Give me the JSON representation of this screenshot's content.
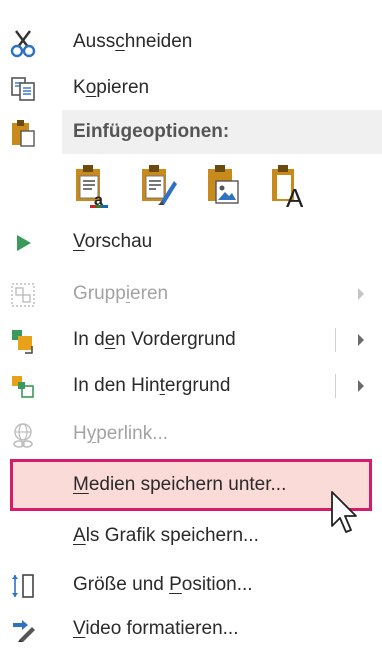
{
  "menu": {
    "cut": {
      "label": "Ausschneiden",
      "icon": "scissors-icon"
    },
    "copy": {
      "label": "Kopieren",
      "icon": "copy-icon"
    },
    "paste_options": {
      "label": "Einfügeoptionen:",
      "icon": "clipboard-icon"
    },
    "paste_buttons": [
      {
        "icon": "paste-keep-source-formatting-icon"
      },
      {
        "icon": "paste-use-destination-theme-icon"
      },
      {
        "icon": "paste-picture-icon"
      },
      {
        "icon": "paste-text-only-icon",
        "glyph": "A"
      }
    ],
    "preview": {
      "label": "Vorschau",
      "icon": "play-icon"
    },
    "group": {
      "label": "Gruppieren",
      "icon": "group-icon",
      "enabled": false
    },
    "bring_forward": {
      "label": "In den Vordergrund",
      "icon": "bring-to-front-icon"
    },
    "send_backward": {
      "label": "In den Hintergrund",
      "icon": "send-to-back-icon"
    },
    "hyperlink": {
      "label": "Hyperlink...",
      "icon": "hyperlink-globe-icon",
      "enabled": false
    },
    "save_media": {
      "label": "Medien speichern unter...",
      "highlighted": true
    },
    "save_as_picture": {
      "label": "Als Grafik speichern..."
    },
    "size_position": {
      "label": "Größe und Position...",
      "icon": "size-position-icon"
    },
    "format_video": {
      "label": "Video formatieren...",
      "icon": "format-video-icon"
    }
  },
  "colors": {
    "highlight_border": "#d61b6a",
    "highlight_fill": "#fadbd8",
    "clipboard": "#c98a1c",
    "accent_green": "#3a9a5b",
    "accent_blue": "#2f72c2",
    "disabled_text": "#a3a3a3"
  }
}
